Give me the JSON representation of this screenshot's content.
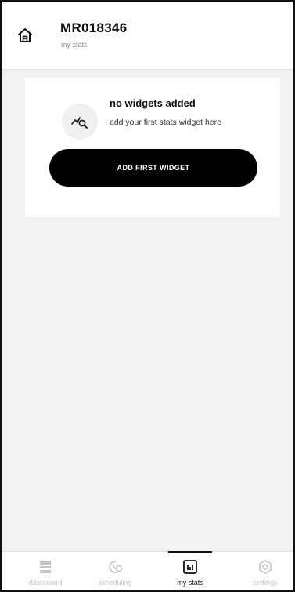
{
  "header": {
    "title": "MR018346",
    "subtitle": "my stats",
    "home_icon": "home-icon"
  },
  "empty_state": {
    "icon": "stats-search-icon",
    "title": "no widgets added",
    "subtitle": "add your first stats widget here",
    "button_label": "ADD FIRST WIDGET"
  },
  "tabs": [
    {
      "label": "dashboard",
      "icon": "dashboard-icon",
      "active": false
    },
    {
      "label": "scheduling",
      "icon": "scheduling-icon",
      "active": false
    },
    {
      "label": "my stats",
      "icon": "stats-chart-icon",
      "active": true
    },
    {
      "label": "settings",
      "icon": "settings-icon",
      "active": false
    }
  ],
  "colors": {
    "background": "#f2f2f2",
    "surface": "#ffffff",
    "primary": "#000000",
    "inactive": "#c4c4c4"
  }
}
